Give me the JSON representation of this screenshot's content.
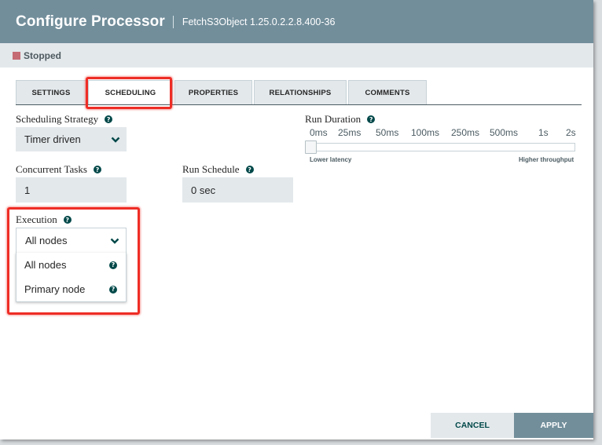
{
  "dialog": {
    "title": "Configure Processor",
    "subtitle": "FetchS3Object 1.25.0.2.2.8.400-36"
  },
  "status": {
    "text": "Stopped",
    "color": "#c56b74"
  },
  "tabs": [
    {
      "label": "SETTINGS",
      "active": false
    },
    {
      "label": "SCHEDULING",
      "active": true
    },
    {
      "label": "PROPERTIES",
      "active": false
    },
    {
      "label": "RELATIONSHIPS",
      "active": false
    },
    {
      "label": "COMMENTS",
      "active": false
    }
  ],
  "scheduling_strategy": {
    "label": "Scheduling Strategy",
    "value": "Timer driven",
    "help_icon": "question-circle-icon"
  },
  "concurrent_tasks": {
    "label": "Concurrent Tasks",
    "value": "1"
  },
  "run_schedule": {
    "label": "Run Schedule",
    "value": "0 sec"
  },
  "run_duration": {
    "label": "Run Duration",
    "ticks": [
      "0ms",
      "25ms",
      "50ms",
      "100ms",
      "250ms",
      "500ms",
      "1s",
      "2s"
    ],
    "selected": "0ms",
    "low_label": "Lower latency",
    "high_label": "Higher throughput"
  },
  "execution": {
    "label": "Execution",
    "value": "All nodes",
    "options": [
      "All nodes",
      "Primary node"
    ]
  },
  "buttons": {
    "cancel": "CANCEL",
    "apply": "APPLY"
  },
  "colors": {
    "header": "#728e9b",
    "accent": "#004849",
    "annotation": "#ee2d25"
  }
}
